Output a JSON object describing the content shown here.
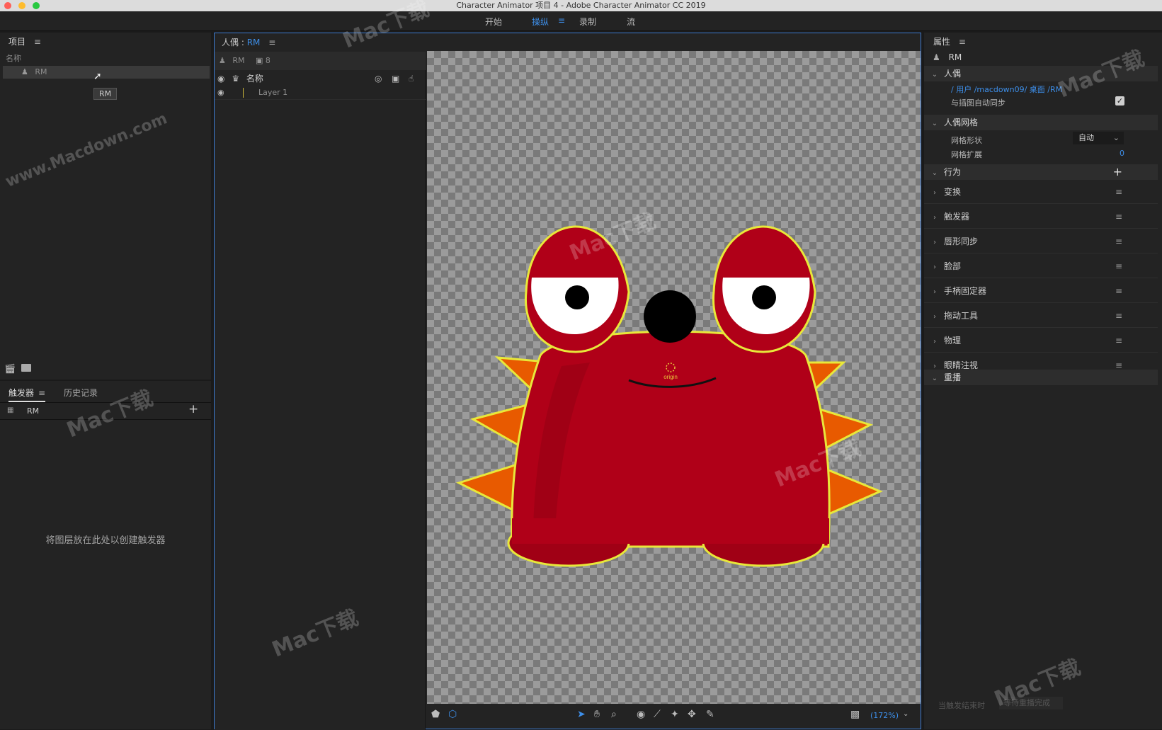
{
  "window": {
    "title": "Character Animator 项目 4 - Adobe Character Animator CC 2019"
  },
  "menu": {
    "items": [
      "开始",
      "操纵",
      "录制",
      "流"
    ],
    "active_index": 1,
    "menu_icon": "≡"
  },
  "project_panel": {
    "title": "项目",
    "column_header": "名称",
    "item_label": "RM",
    "tooltip": "RM"
  },
  "triggers_panel": {
    "tab_triggers": "触发器",
    "tab_history": "历史记录",
    "puppet_label": "RM",
    "empty_message": "将图层放在此处以创建触发器"
  },
  "puppet_panel": {
    "title_prefix": "人偶 : ",
    "title_name": "RM",
    "puppet_label": "RM",
    "camera_count": "8",
    "column_name": "名称",
    "layer_name": "Layer 1",
    "zoom": "(172%)",
    "origin_label": "origin"
  },
  "properties_panel": {
    "title": "属性",
    "puppet_name": "RM",
    "section_puppet": "人偶",
    "path_text": "/ 用户 /macdown09/ 桌面 /RM",
    "auto_sync_label": "与插图自动同步",
    "section_mesh": "人偶网格",
    "mesh_shape_label": "网格形状",
    "mesh_shape_value": "自动",
    "mesh_expand_label": "网格扩展",
    "mesh_expand_value": "0",
    "section_behaviors": "行为",
    "behaviors": [
      "变换",
      "触发器",
      "唇形同步",
      "脸部",
      "手柄固定器",
      "拖动工具",
      "物理",
      "眼睛注视"
    ],
    "section_replay": "重播",
    "footer_label": "当触发结束时",
    "footer_value": "等待重播完成"
  },
  "colors": {
    "accent": "#3d8ee8",
    "body": "#b00018",
    "spike": "#e85a00",
    "outline": "#e8e83a"
  },
  "watermark": {
    "text": "Mac下载",
    "sub": "www.Macdown.com"
  }
}
